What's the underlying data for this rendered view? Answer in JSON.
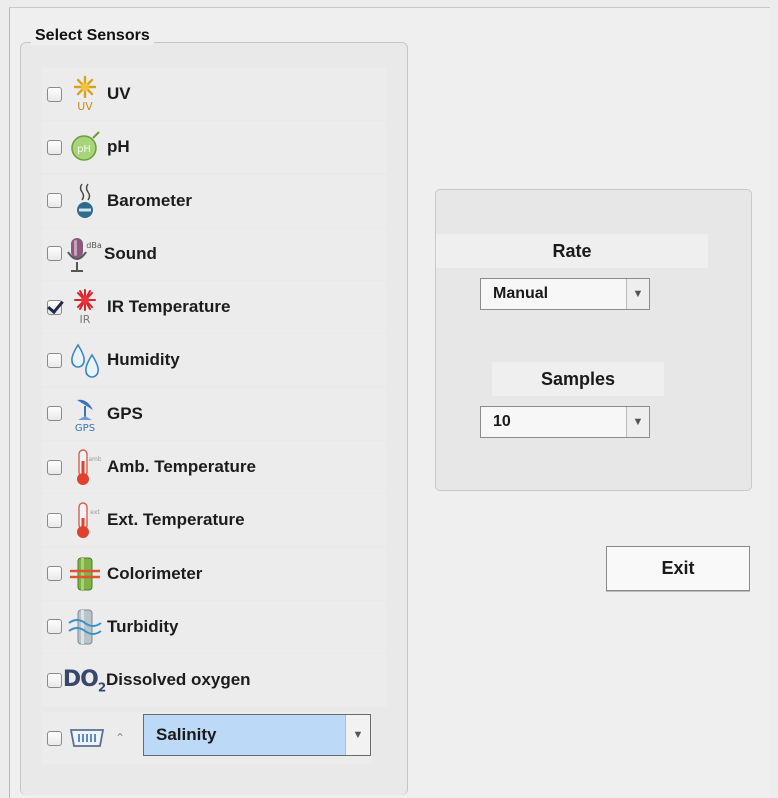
{
  "group_title": "Select Sensors",
  "sensors": [
    {
      "label": "UV",
      "icon": "uv-sun-icon",
      "checked": false
    },
    {
      "label": "pH",
      "icon": "ph-leaf-icon",
      "checked": false
    },
    {
      "label": "Barometer",
      "icon": "barometer-icon",
      "checked": false
    },
    {
      "label": "Sound",
      "icon": "microphone-icon",
      "checked": false
    },
    {
      "label": "IR Temperature",
      "icon": "ir-burst-icon",
      "checked": true
    },
    {
      "label": "Humidity",
      "icon": "water-drops-icon",
      "checked": false
    },
    {
      "label": "GPS",
      "icon": "satellite-dish-icon",
      "checked": false
    },
    {
      "label": "Amb. Temperature",
      "icon": "thermometer-amb-icon",
      "checked": false
    },
    {
      "label": "Ext. Temperature",
      "icon": "thermometer-ext-icon",
      "checked": false
    },
    {
      "label": "Colorimeter",
      "icon": "colorimeter-icon",
      "checked": false
    },
    {
      "label": "Turbidity",
      "icon": "turbidity-icon",
      "checked": false
    },
    {
      "label": "Dissolved oxygen",
      "icon": "do2-icon",
      "checked": false
    }
  ],
  "icon_text": {
    "uv": "UV",
    "ir": "IR",
    "gps": "GPS",
    "do2_main": "DO",
    "do2_sub": "2",
    "sound_db": "dBa",
    "thermo_amb": "amb",
    "thermo_ext": "ext",
    "ph": "pH"
  },
  "salinity": {
    "checked": false,
    "selected": "Salinity",
    "icon": "salinity-probe-icon"
  },
  "rate": {
    "label": "Rate",
    "selected": "Manual"
  },
  "samples": {
    "label": "Samples",
    "selected": "10"
  },
  "exit_label": "Exit",
  "colors": {
    "salinity_highlight": "#bcd9f7",
    "check_mark": "#1d2a4a"
  }
}
